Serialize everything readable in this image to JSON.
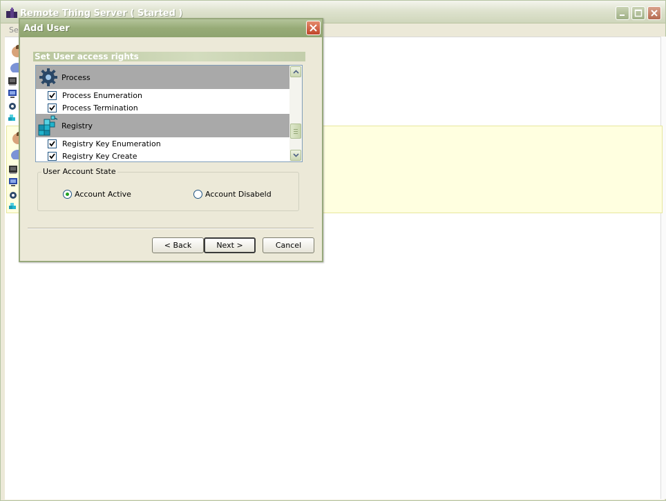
{
  "main_window": {
    "title": "Remote Thing Server ( Started )",
    "menu": [
      "Ser"
    ]
  },
  "dialog": {
    "title": "Add User",
    "section_header": "Set User access rights",
    "groups": [
      {
        "label": "Process",
        "icon": "gear-icon",
        "rights": [
          {
            "label": "Process Enumeration",
            "checked": true
          },
          {
            "label": "Process Termination",
            "checked": true
          }
        ]
      },
      {
        "label": "Registry",
        "icon": "registry-cubes-icon",
        "rights": [
          {
            "label": "Registry Key Enumeration",
            "checked": true
          },
          {
            "label": "Registry Key Create",
            "checked": true
          }
        ]
      }
    ],
    "account_state": {
      "legend": "User Account State",
      "options": [
        {
          "label": "Account Active",
          "selected": true
        },
        {
          "label": "Account Disabeld",
          "selected": false
        }
      ]
    },
    "buttons": {
      "back": "< Back",
      "next": "Next >",
      "cancel": "Cancel"
    }
  },
  "colors": {
    "dialog_title_bar": "#97ab77",
    "group_header_bg": "#a9a9a9",
    "selected_row_bg": "#ffffe0",
    "radio_dot": "#21a121"
  }
}
